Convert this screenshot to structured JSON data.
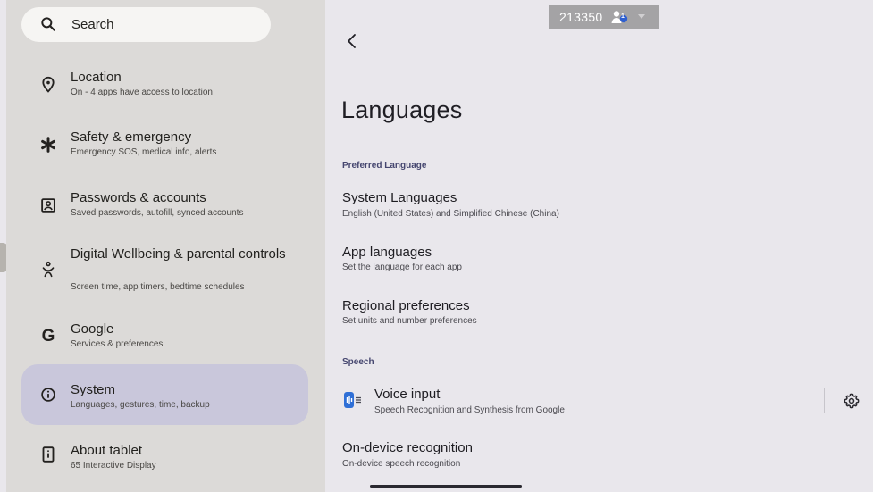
{
  "search": {
    "placeholder": "Search"
  },
  "sidebar": {
    "items": [
      {
        "title": "Location",
        "subtitle": "On - 4 apps have access to location",
        "icon": "location-pin-icon"
      },
      {
        "title": "Safety & emergency",
        "subtitle": "Emergency SOS, medical info, alerts",
        "icon": "asterisk-icon"
      },
      {
        "title": "Passwords & accounts",
        "subtitle": "Saved passwords, autofill, synced accounts",
        "icon": "account-box-icon"
      },
      {
        "title": "Digital Wellbeing & parental controls",
        "subtitle": "Screen time, app timers, bedtime schedules",
        "icon": "wellbeing-icon"
      },
      {
        "title": "Google",
        "subtitle": "Services & preferences",
        "icon": "google-g-icon"
      },
      {
        "title": "System",
        "subtitle": "Languages, gestures, time, backup",
        "icon": "info-circle-icon",
        "selected": true
      },
      {
        "title": "About tablet",
        "subtitle": "65 Interactive Display",
        "icon": "tablet-icon"
      }
    ]
  },
  "main": {
    "title": "Languages",
    "sections": {
      "preferred": "Preferred Language",
      "speech": "Speech"
    },
    "prefs": {
      "system_languages": {
        "title": "System Languages",
        "subtitle": "English (United States) and Simplified Chinese (China)"
      },
      "app_languages": {
        "title": "App languages",
        "subtitle": "Set the language for each app"
      },
      "regional": {
        "title": "Regional preferences",
        "subtitle": "Set units and number preferences"
      },
      "voice_input": {
        "title": "Voice input",
        "subtitle": "Speech Recognition and Synthesis from Google"
      },
      "on_device": {
        "title": "On-device recognition",
        "subtitle": "On-device speech recognition"
      }
    }
  },
  "overlay": {
    "id_text": "213350",
    "user_count": "1"
  },
  "colors": {
    "left_bg": "#dcdad8",
    "right_bg": "#e9e7ec",
    "selected_bg": "#c9c7db",
    "accent": "#45466f",
    "voice_blue": "#2f6fd6"
  }
}
